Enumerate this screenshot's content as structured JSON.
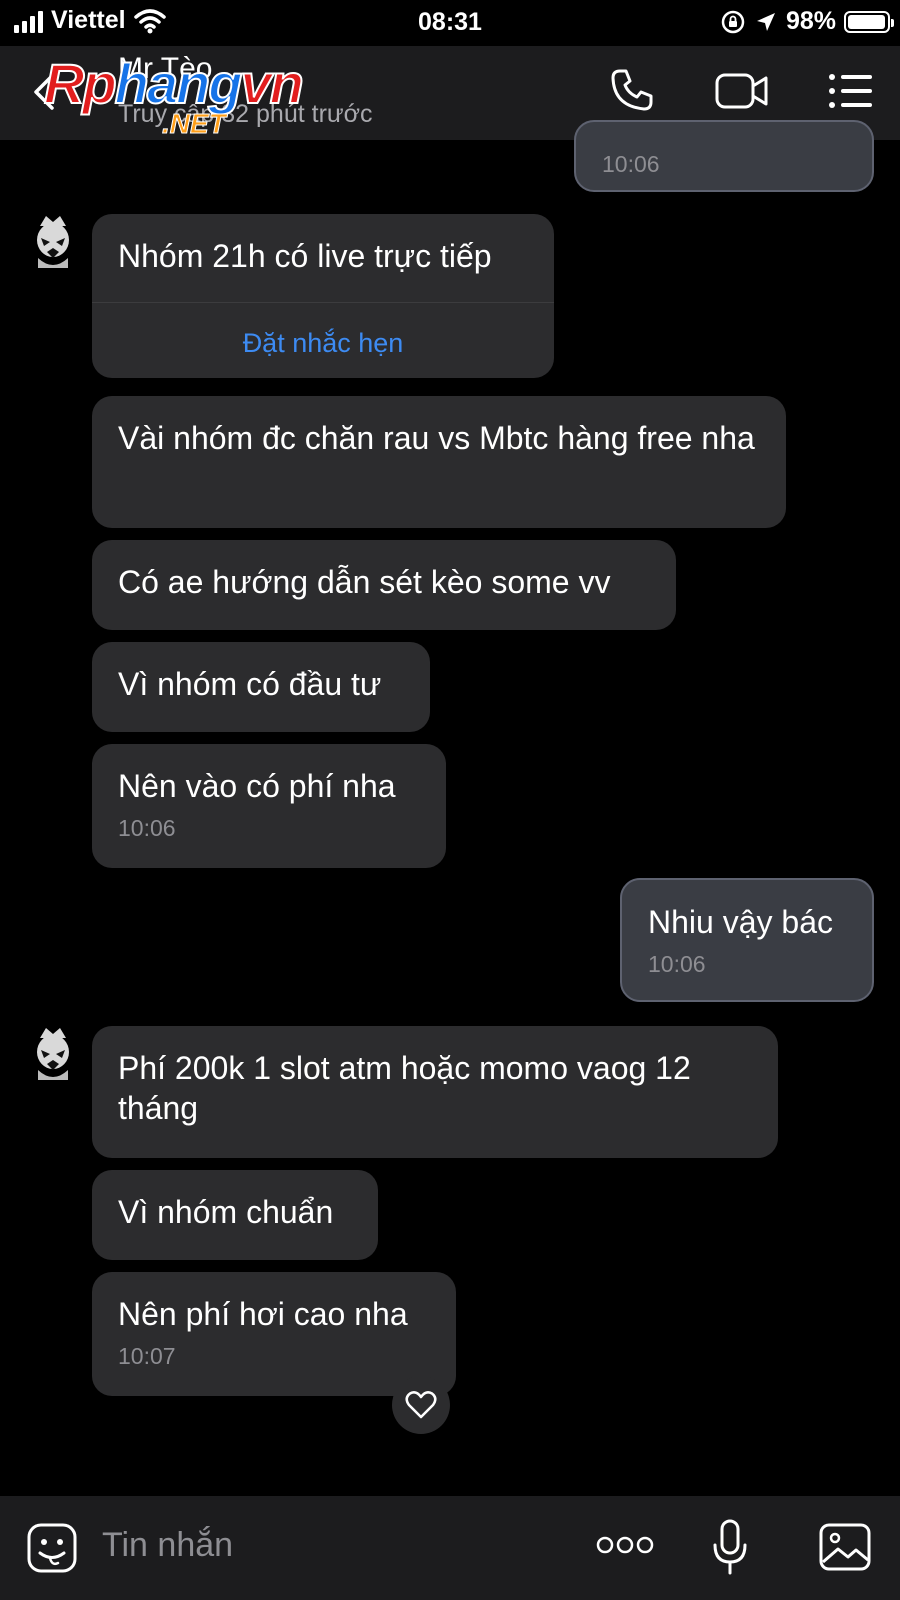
{
  "status_bar": {
    "carrier": "Viettel",
    "time": "08:31",
    "battery": "98%",
    "battery_level": 0.98
  },
  "header": {
    "contact_name": "Mr Tèo",
    "last_seen": "Truy cập 32 phút trước",
    "watermark": {
      "part1": "Rp",
      "part2": "hang",
      "part3": "vn",
      "net": ".NET"
    },
    "icons": [
      "back-icon",
      "phone-icon",
      "video-call-icon",
      "menu-icon"
    ]
  },
  "messages": [
    {
      "side": "sent",
      "time": "10:06"
    },
    {
      "side": "received",
      "text": "Nhóm 21h có live trực tiếp",
      "action": "Đặt nhắc hẹn"
    },
    {
      "side": "received",
      "text": "Vài nhóm đc chăn rau vs Mbtc hàng free nha"
    },
    {
      "side": "received",
      "text": "Có ae hướng dẫn sét kèo some vv"
    },
    {
      "side": "received",
      "text": "Vì nhóm có đầu tư"
    },
    {
      "side": "received",
      "text": "Nên vào có phí nha",
      "time": "10:06"
    },
    {
      "side": "sent",
      "text": "Nhiu vậy bác",
      "time": "10:06"
    },
    {
      "side": "received",
      "text": "Phí 200k 1 slot atm hoặc momo vaog 12 tháng"
    },
    {
      "side": "received",
      "text": "Vì nhóm chuẩn"
    },
    {
      "side": "received",
      "text": "Nên phí hơi cao nha",
      "time": "10:07"
    }
  ],
  "composer": {
    "placeholder": "Tin nhắn",
    "icons": [
      "sticker-icon",
      "more-icon",
      "microphone-icon",
      "image-icon"
    ]
  },
  "colors": {
    "background": "#000000",
    "bar": "#1c1c1e",
    "received_bubble": "#2c2c2e",
    "sent_bubble": "#3a3d44",
    "link": "#3d8bf2"
  }
}
